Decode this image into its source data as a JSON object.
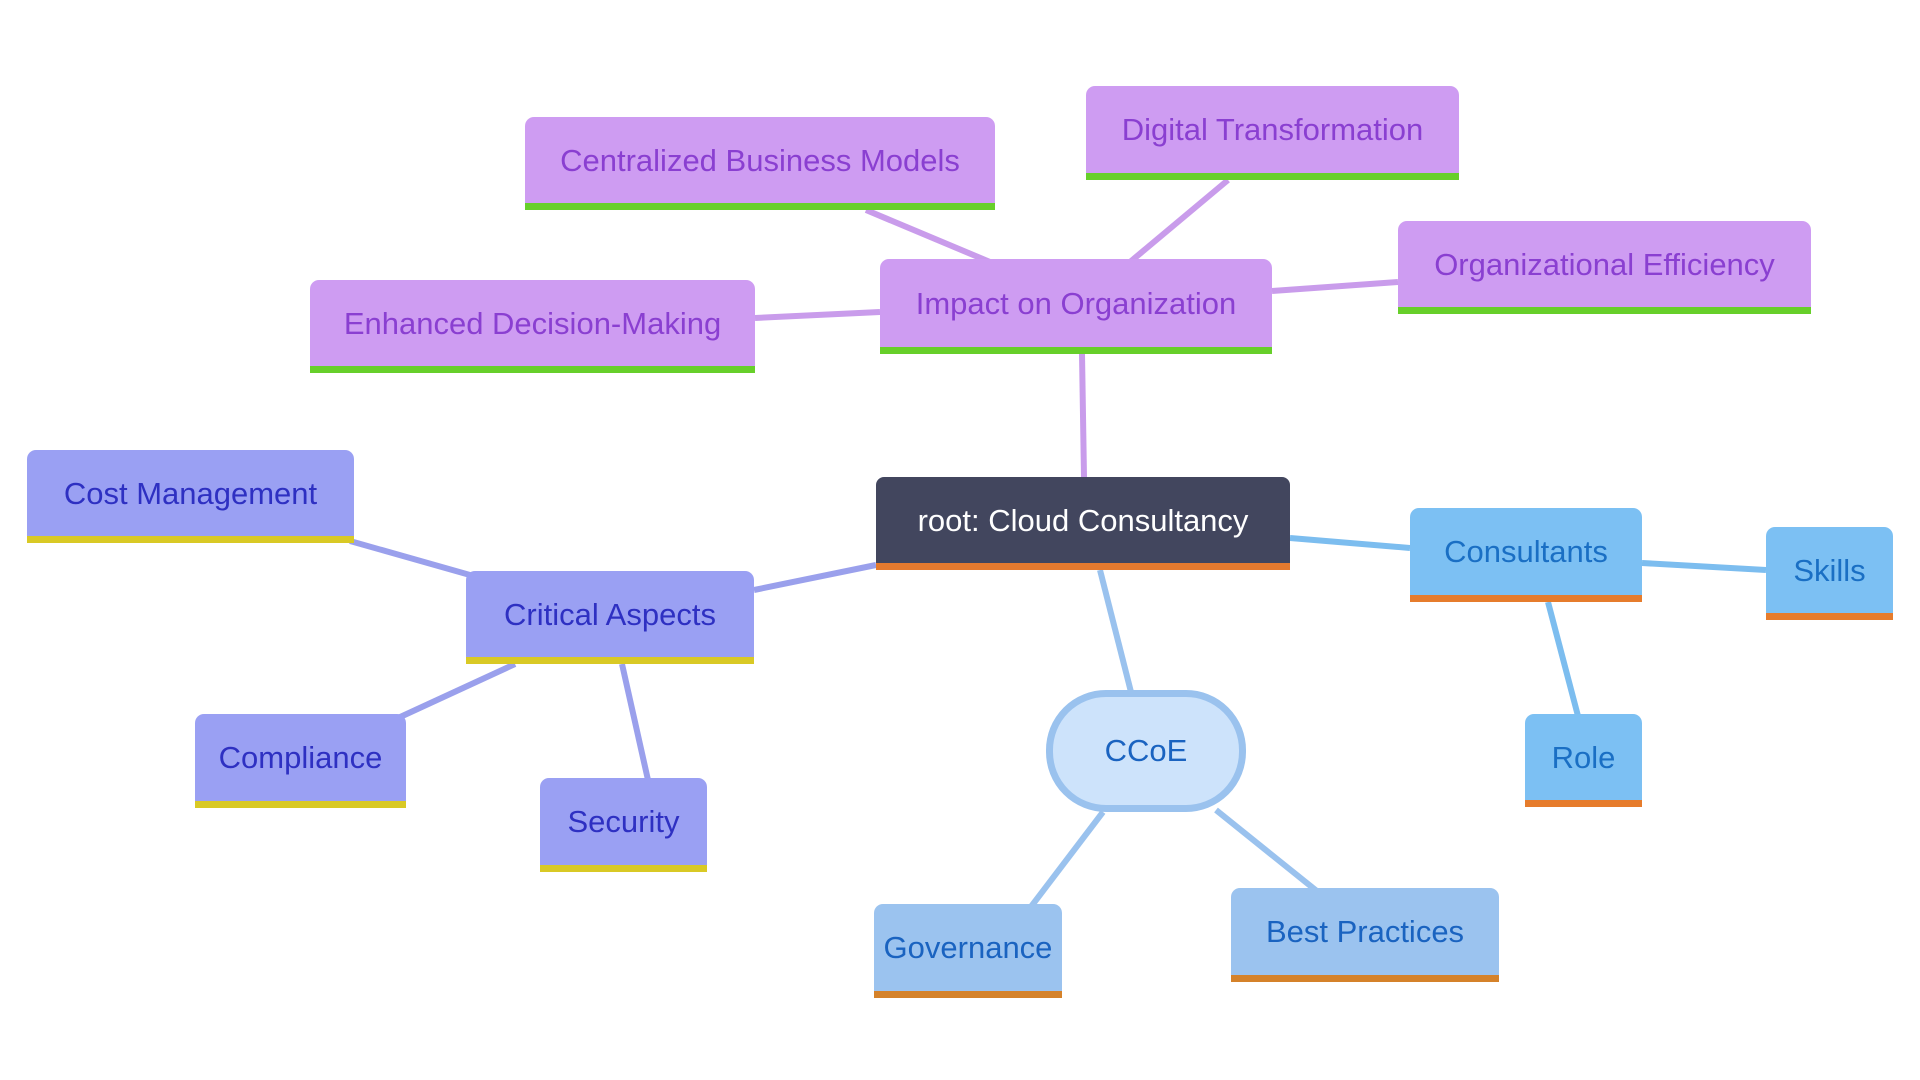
{
  "diagram": {
    "type": "mindmap",
    "root": {
      "id": "root",
      "label": "root: Cloud Consultancy"
    },
    "branches": [
      {
        "id": "impact",
        "label": "Impact on Organization",
        "theme": "purple",
        "children": [
          {
            "id": "centralized",
            "label": "Centralized Business Models"
          },
          {
            "id": "digital",
            "label": "Digital Transformation"
          },
          {
            "id": "efficiency",
            "label": "Organizational Efficiency"
          },
          {
            "id": "decision",
            "label": "Enhanced Decision-Making"
          }
        ]
      },
      {
        "id": "critical",
        "label": "Critical Aspects",
        "theme": "violet",
        "children": [
          {
            "id": "cost",
            "label": "Cost Management"
          },
          {
            "id": "compliance",
            "label": "Compliance"
          },
          {
            "id": "security",
            "label": "Security"
          }
        ]
      },
      {
        "id": "ccoe",
        "label": "CCoE",
        "theme": "light",
        "children": [
          {
            "id": "governance",
            "label": "Governance"
          },
          {
            "id": "bestpractices",
            "label": "Best Practices"
          }
        ]
      },
      {
        "id": "consultants",
        "label": "Consultants",
        "theme": "sky",
        "children": [
          {
            "id": "skills",
            "label": "Skills"
          },
          {
            "id": "role",
            "label": "Role"
          }
        ]
      }
    ]
  },
  "colors": {
    "purple": {
      "fill": "#ce9cf2",
      "text": "#8a3fd1",
      "bar": "#67cf2a",
      "edge": "#c99ceb"
    },
    "violet": {
      "fill": "#9aa0f3",
      "text": "#2e30c2",
      "bar": "#d9c925",
      "edge": "#9aa0ec"
    },
    "sky": {
      "fill": "#7cc0f3",
      "text": "#1a6fc4",
      "bar": "#e67c2c",
      "edge": "#7cbdef"
    },
    "light": {
      "fill": "#9bc3ef",
      "text": "#1a63c0",
      "bar": "#d5822a",
      "edge": "#9ac2ee"
    },
    "root": {
      "fill": "#42465e",
      "text": "#ffffff",
      "bar": "#e57a2e"
    }
  }
}
